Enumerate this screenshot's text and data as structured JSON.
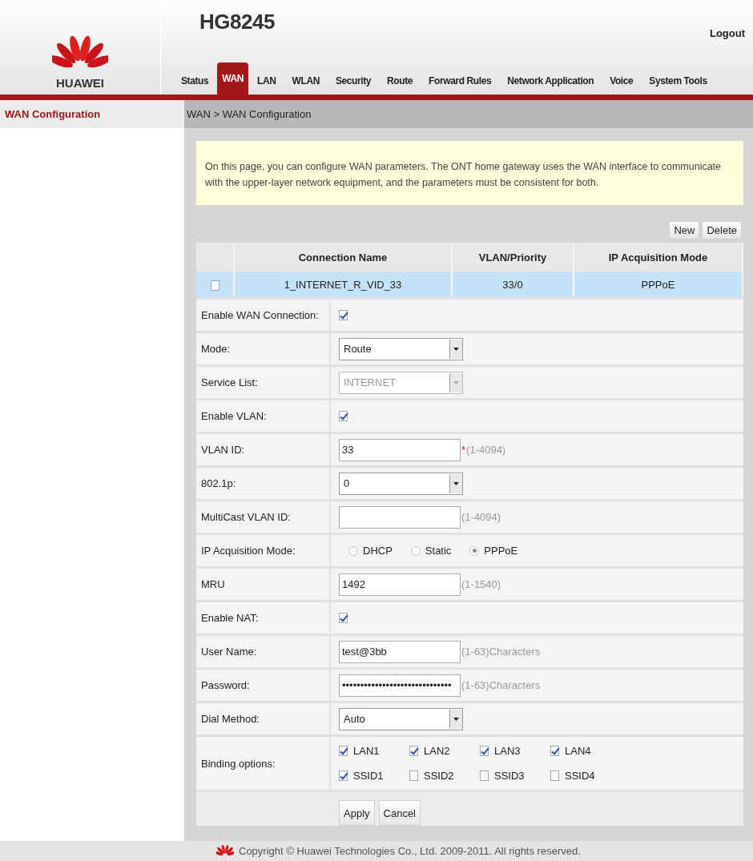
{
  "header": {
    "brand": "HUAWEI",
    "model": "HG8245",
    "logout": "Logout"
  },
  "tabs": [
    {
      "label": "Status",
      "selected": false
    },
    {
      "label": "WAN",
      "selected": true
    },
    {
      "label": "LAN",
      "selected": false
    },
    {
      "label": "WLAN",
      "selected": false
    },
    {
      "label": "Security",
      "selected": false
    },
    {
      "label": "Route",
      "selected": false
    },
    {
      "label": "Forward Rules",
      "selected": false
    },
    {
      "label": "Network Application",
      "selected": false
    },
    {
      "label": "Voice",
      "selected": false
    },
    {
      "label": "System Tools",
      "selected": false
    }
  ],
  "sidebar": {
    "items": [
      {
        "label": "WAN Configuration",
        "selected": true
      }
    ]
  },
  "breadcrumb": "WAN > WAN Configuration",
  "notice": "On this page, you can configure WAN parameters. The ONT home gateway uses the WAN interface to communicate with the upper-layer network equipment, and the parameters must be consistent for both.",
  "toolbar": [
    "New",
    "Delete"
  ],
  "table": {
    "columns": [
      "Connection Name",
      "VLAN/Priority",
      "IP Acquisition Mode"
    ],
    "rows": [
      {
        "checked": false,
        "selected": true,
        "cells": [
          "1_INTERNET_R_VID_33",
          "33/0",
          "PPPoE"
        ]
      }
    ]
  },
  "form": [
    {
      "kind": "checkbox",
      "label": "Enable WAN Connection:",
      "checked": true
    },
    {
      "kind": "select",
      "label": "Mode:",
      "value": "Route",
      "disabled": false
    },
    {
      "kind": "select",
      "label": "Service List:",
      "value": "INTERNET",
      "disabled": true
    },
    {
      "kind": "checkbox",
      "label": "Enable VLAN:",
      "checked": true
    },
    {
      "kind": "text",
      "label": "VLAN ID:",
      "value": "33",
      "mark": "*",
      "hint": "(1-4094)"
    },
    {
      "kind": "select",
      "label": "802.1p:",
      "value": "0",
      "disabled": false
    },
    {
      "kind": "text",
      "label": "MultiCast VLAN ID:",
      "hint": "(1-4094)"
    },
    {
      "kind": "radio",
      "label": "IP Acquisition Mode:",
      "options": [
        {
          "label": "DHCP",
          "selected": false
        },
        {
          "label": "Static",
          "selected": false
        },
        {
          "label": "PPPoE",
          "selected": true
        }
      ]
    },
    {
      "kind": "text",
      "label": "MRU",
      "value": "1492",
      "hint": "(1-1540)"
    },
    {
      "kind": "checkbox",
      "label": "Enable NAT:",
      "checked": true
    },
    {
      "kind": "text",
      "label": "User Name:",
      "value": "test@3bb",
      "hint": "(1-63)Characters"
    },
    {
      "kind": "text",
      "label": "Password:",
      "value": "••••••••••••••••••••••••••••••",
      "hint": "(1-63)Characters"
    },
    {
      "kind": "select",
      "label": "Dial Method:",
      "value": "Auto",
      "disabled": false
    },
    {
      "kind": "binding",
      "label": "Binding options:",
      "options": [
        {
          "label": "LAN1",
          "checked": true
        },
        {
          "label": "LAN2",
          "checked": true
        },
        {
          "label": "LAN3",
          "checked": true
        },
        {
          "label": "LAN4",
          "checked": true
        },
        {
          "label": "SSID1",
          "checked": true
        },
        {
          "label": "SSID2",
          "checked": false
        },
        {
          "label": "SSID3",
          "checked": false
        },
        {
          "label": "SSID4",
          "checked": false
        }
      ]
    }
  ],
  "actions": [
    "Apply",
    "Cancel"
  ],
  "footer": "Copyright © Huawei Technologies Co., Ltd. 2009-2011. All rights reserved."
}
